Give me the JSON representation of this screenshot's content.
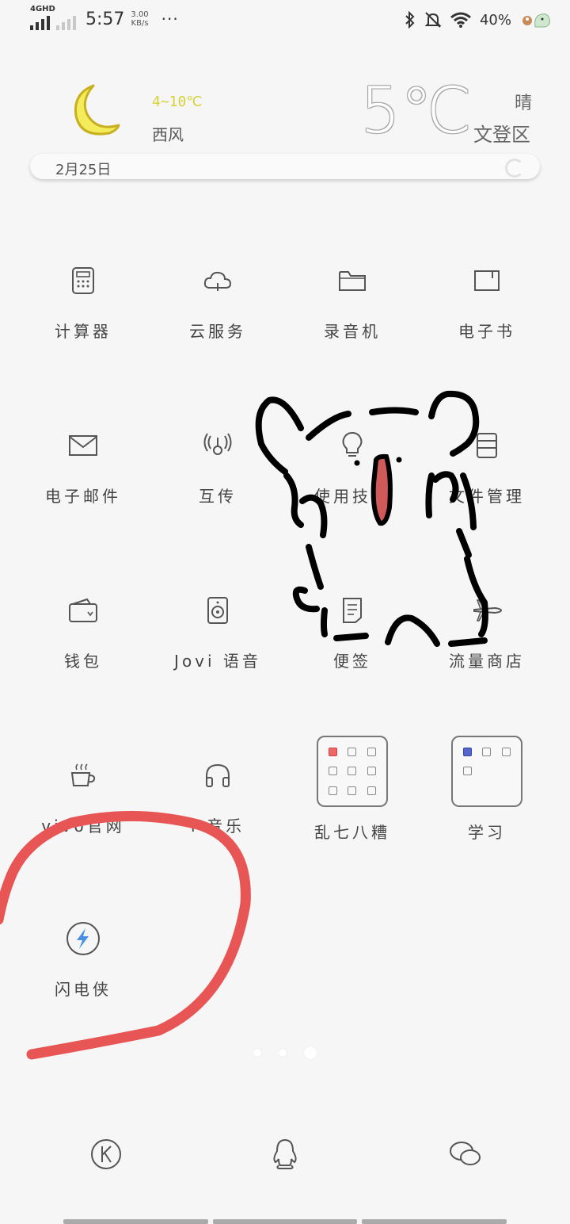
{
  "status_bar": {
    "network": "4GHD",
    "time": "5:57",
    "speed_value": "3.00",
    "speed_unit": "KB/s",
    "more": "···",
    "battery": "40%",
    "icons": [
      "bluetooth-icon",
      "mute-icon",
      "wifi-icon",
      "battery-icon"
    ]
  },
  "weather": {
    "temp_range": "4~10℃",
    "wind": "西风",
    "current_temp": "5℃",
    "condition": "晴",
    "district": "文登区",
    "date": "2月25日",
    "colors": {
      "range_text": "#d8d23a",
      "moon": "#e8d830"
    }
  },
  "apps": [
    {
      "label": "计算器",
      "icon": "calculator-icon"
    },
    {
      "label": "云服务",
      "icon": "cloud-icon"
    },
    {
      "label": "录音机",
      "icon": "folder-icon"
    },
    {
      "label": "电子书",
      "icon": "book-icon"
    },
    {
      "label": "电子邮件",
      "icon": "mail-icon"
    },
    {
      "label": "互传",
      "icon": "share-icon"
    },
    {
      "label": "使用技巧",
      "icon": "bulb-icon"
    },
    {
      "label": "文件管理",
      "icon": "file-manager-icon"
    },
    {
      "label": "钱包",
      "icon": "wallet-icon"
    },
    {
      "label": "Jovi 语音",
      "icon": "speaker-icon"
    },
    {
      "label": "便签",
      "icon": "note-icon"
    },
    {
      "label": "流量商店",
      "icon": "plane-icon"
    },
    {
      "label": "vivo官网",
      "icon": "cup-icon"
    },
    {
      "label": "i 音乐",
      "icon": "headphones-icon"
    },
    {
      "label": "乱七八糟",
      "icon": "folder-group-icon"
    },
    {
      "label": "学习",
      "icon": "folder-group-icon"
    },
    {
      "label": "闪电侠",
      "icon": "lightning-icon"
    }
  ],
  "page_indicator": {
    "pages": 3,
    "current": 3
  },
  "dock": [
    {
      "name": "kuwo-icon"
    },
    {
      "name": "qq-icon"
    },
    {
      "name": "wechat-icon"
    }
  ],
  "annotation": {
    "circle_color": "#e85555"
  }
}
